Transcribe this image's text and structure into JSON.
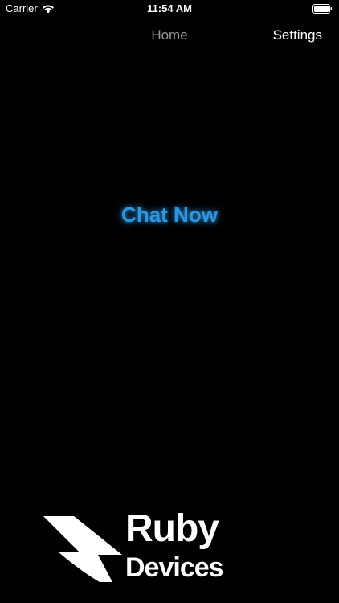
{
  "status_bar": {
    "carrier": "Carrier",
    "time": "11:54 AM",
    "icons": [
      "wifi-icon",
      "battery-icon"
    ]
  },
  "nav": {
    "title": "Home",
    "settings_label": "Settings"
  },
  "main": {
    "chat_label": "Chat Now"
  },
  "brand": {
    "line1": "Ruby",
    "line2": "Devices"
  },
  "colors": {
    "background": "#000000",
    "accent": "#2e96df",
    "nav_title": "#9a9a9a",
    "text": "#ffffff"
  }
}
